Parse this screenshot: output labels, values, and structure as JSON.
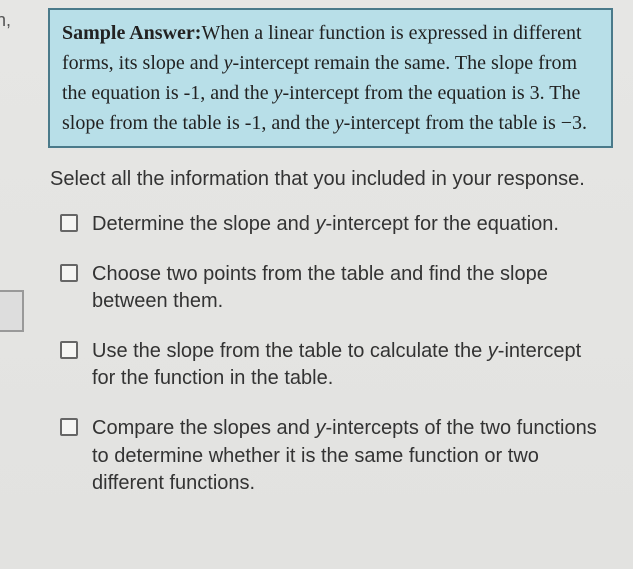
{
  "partialLabel": "on,",
  "sampleAnswer": {
    "label": "Sample Answer:",
    "text_parts": [
      "When a linear function is expressed in different forms, its slope and ",
      "y",
      "-intercept remain the same. The slope from the equation is -1, and the ",
      "y",
      "-intercept from the equation is 3. The slope from the table is -1, and the ",
      "y",
      "-intercept from the table is −3."
    ]
  },
  "prompt": "Select all the information that you included in your response.",
  "options": [
    {
      "parts": [
        "Determine the slope and ",
        "y",
        "-intercept for the equation."
      ]
    },
    {
      "parts": [
        "Choose two points from the table and find the slope between them."
      ]
    },
    {
      "parts": [
        "Use the slope from the table to calculate the ",
        "y",
        "-intercept for the function in the table."
      ]
    },
    {
      "parts": [
        "Compare the slopes and ",
        "y",
        "-intercepts of the two functions to determine whether it is the same function or two different functions."
      ]
    }
  ]
}
